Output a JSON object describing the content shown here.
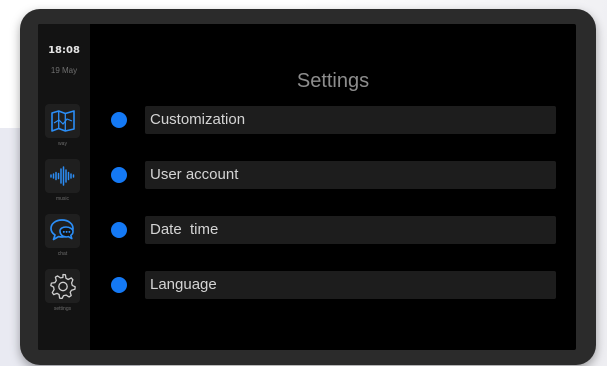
{
  "status": {
    "time": "18:08",
    "date": "19 May"
  },
  "sidebar": {
    "items": [
      {
        "label": "way",
        "icon": "map-icon"
      },
      {
        "label": "music",
        "icon": "waveform-icon"
      },
      {
        "label": "chat",
        "icon": "chat-bubbles-icon"
      },
      {
        "label": "settings",
        "icon": "gear-icon"
      }
    ]
  },
  "main": {
    "title": "Settings",
    "options": [
      {
        "label": "Customization"
      },
      {
        "label": "User account"
      },
      {
        "label": "Date  time"
      },
      {
        "label": "Language"
      }
    ]
  },
  "colors": {
    "accent": "#1479f5",
    "screen_background": "#000000",
    "sidebar_background": "#131313",
    "option_background": "#1d1d1d",
    "bezel": "#2b2b2b"
  }
}
